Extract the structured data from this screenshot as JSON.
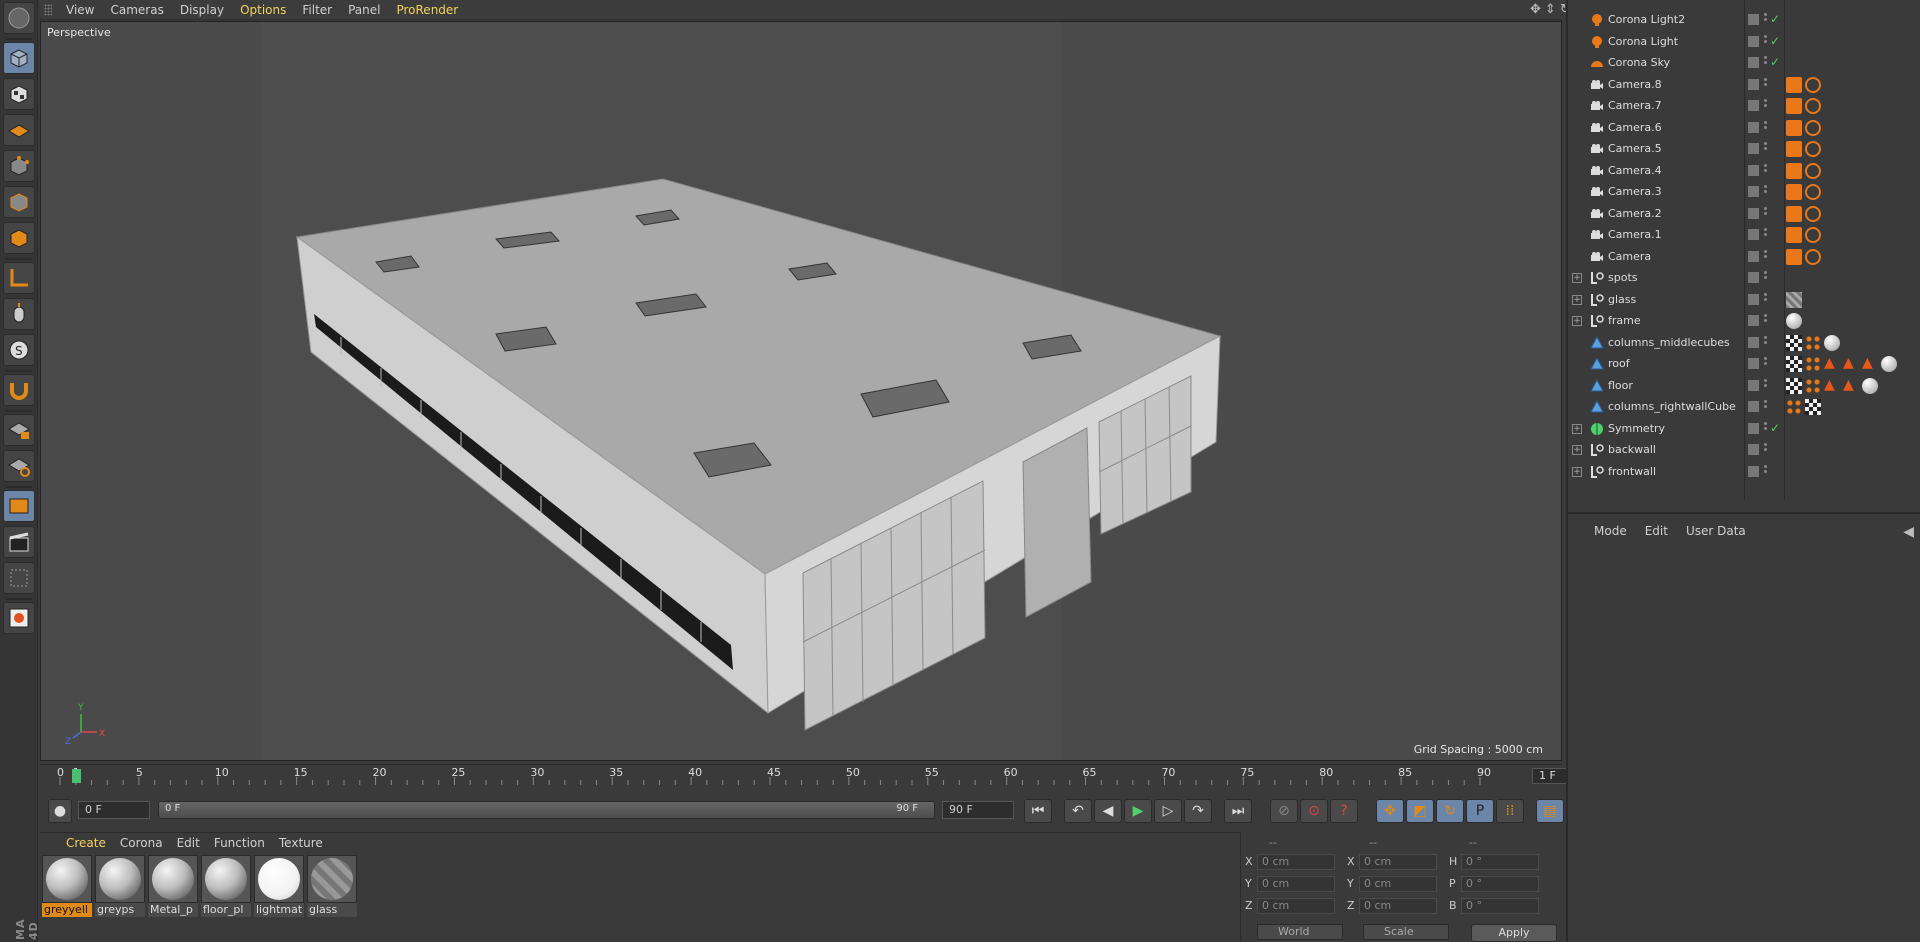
{
  "viewport": {
    "menu": [
      {
        "label": "View",
        "highlight": false
      },
      {
        "label": "Cameras",
        "highlight": false
      },
      {
        "label": "Display",
        "highlight": false
      },
      {
        "label": "Options",
        "highlight": true
      },
      {
        "label": "Filter",
        "highlight": false
      },
      {
        "label": "Panel",
        "highlight": false
      },
      {
        "label": "ProRender",
        "highlight": true
      }
    ],
    "label": "Perspective",
    "grid_spacing": "Grid Spacing : 5000 cm",
    "axis": {
      "x": "X",
      "y": "Y",
      "z": "Z"
    }
  },
  "timeline": {
    "ticks": [
      "0",
      "1",
      "5",
      "10",
      "15",
      "20",
      "25",
      "30",
      "35",
      "40",
      "45",
      "50",
      "55",
      "60",
      "65",
      "70",
      "75",
      "80",
      "85",
      "90"
    ],
    "current_frame": "1 F",
    "playhead_value": 1,
    "max_frame": 90
  },
  "transport": {
    "start_field": "0 F",
    "range_start": "0 F",
    "range_end": "90 F",
    "end_field": "90 F"
  },
  "materials": {
    "menu": [
      {
        "label": "Create",
        "highlight": true
      },
      {
        "label": "Corona",
        "highlight": false
      },
      {
        "label": "Edit",
        "highlight": false
      },
      {
        "label": "Function",
        "highlight": false
      },
      {
        "label": "Texture",
        "highlight": false
      }
    ],
    "items": [
      {
        "name": "greyyell",
        "selected": true
      },
      {
        "name": "greyps",
        "selected": false
      },
      {
        "name": "Metal_p",
        "selected": false
      },
      {
        "name": "floor_pl",
        "selected": false
      },
      {
        "name": "lightmat",
        "selected": false
      },
      {
        "name": "glass",
        "selected": false
      }
    ]
  },
  "coordinates": {
    "headers": [
      "--",
      "--",
      "--"
    ],
    "rows": [
      {
        "l1": "X",
        "v1": "0 cm",
        "l2": "X",
        "v2": "0 cm",
        "l3": "H",
        "v3": "0 °"
      },
      {
        "l1": "Y",
        "v1": "0 cm",
        "l2": "Y",
        "v2": "0 cm",
        "l3": "P",
        "v3": "0 °"
      },
      {
        "l1": "Z",
        "v1": "0 cm",
        "l2": "Z",
        "v2": "0 cm",
        "l3": "B",
        "v3": "0 °"
      }
    ],
    "mode_dropdown": "World",
    "scale_dropdown": "Scale",
    "apply_label": "Apply"
  },
  "objects": [
    {
      "name": "Corona Light2",
      "icon": "light-icon",
      "tags": "check"
    },
    {
      "name": "Corona Light",
      "icon": "light-icon",
      "tags": "check"
    },
    {
      "name": "Corona Sky",
      "icon": "sky-icon",
      "tags": "check"
    },
    {
      "name": "Camera.8",
      "icon": "camera-icon",
      "tags": "camera"
    },
    {
      "name": "Camera.7",
      "icon": "camera-icon",
      "tags": "camera"
    },
    {
      "name": "Camera.6",
      "icon": "camera-icon",
      "tags": "camera"
    },
    {
      "name": "Camera.5",
      "icon": "camera-icon",
      "tags": "camera"
    },
    {
      "name": "Camera.4",
      "icon": "camera-icon",
      "tags": "camera"
    },
    {
      "name": "Camera.3",
      "icon": "camera-icon",
      "tags": "camera"
    },
    {
      "name": "Camera.2",
      "icon": "camera-icon",
      "tags": "camera"
    },
    {
      "name": "Camera.1",
      "icon": "camera-icon",
      "tags": "camera"
    },
    {
      "name": "Camera",
      "icon": "camera-icon",
      "tags": "camera"
    },
    {
      "name": "spots",
      "icon": "null-icon",
      "tags": "none",
      "expandable": true
    },
    {
      "name": "glass",
      "icon": "null-icon",
      "tags": "glass",
      "expandable": true
    },
    {
      "name": "frame",
      "icon": "null-icon",
      "tags": "material",
      "expandable": true
    },
    {
      "name": "columns_middlecubes",
      "icon": "polygon-icon",
      "tags": "cubes"
    },
    {
      "name": "roof",
      "icon": "polygon-icon",
      "tags": "roof"
    },
    {
      "name": "floor",
      "icon": "polygon-icon",
      "tags": "floor"
    },
    {
      "name": "columns_rightwallCube",
      "icon": "polygon-icon",
      "tags": "checker"
    },
    {
      "name": "Symmetry",
      "icon": "symmetry-icon",
      "tags": "check",
      "expandable": true
    },
    {
      "name": "backwall",
      "icon": "null-icon",
      "tags": "none",
      "expandable": true
    },
    {
      "name": "frontwall",
      "icon": "null-icon",
      "tags": "none",
      "expandable": true
    }
  ],
  "attributes": {
    "menu": [
      "Mode",
      "Edit",
      "User Data"
    ]
  },
  "brand": "MA 4D",
  "colors": {
    "accent_yellow": "#f2d25c",
    "active_blue": "#6b86a8",
    "selected_orange": "#e08a1a",
    "check_green": "#4fd06a"
  }
}
